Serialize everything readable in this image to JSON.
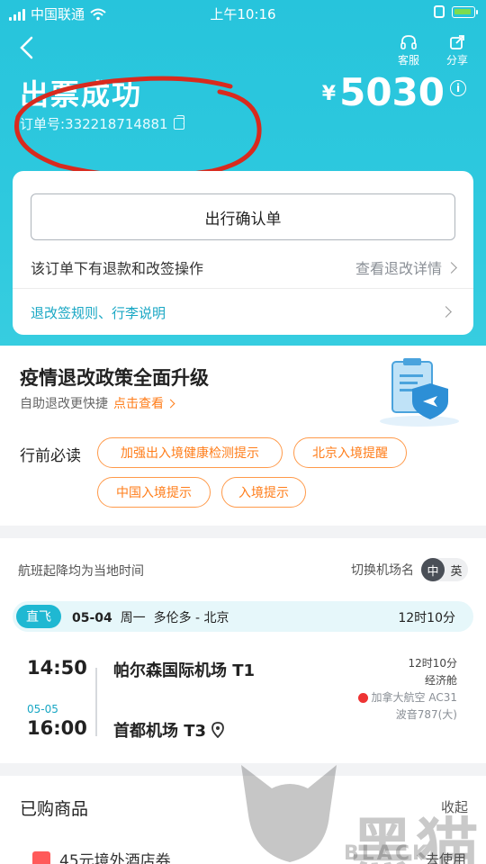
{
  "status_bar": {
    "carrier": "中国联通",
    "time": "上午10:16"
  },
  "header": {
    "actions": [
      {
        "label": "客服",
        "icon": "headset-icon"
      },
      {
        "label": "分享",
        "icon": "share-icon"
      }
    ],
    "title": "出票成功",
    "order_number": "订单号:332218714881",
    "currency": "¥",
    "price": "5030"
  },
  "ticket_card": {
    "confirm_button": "出行确认单",
    "refund_text": "该订单下有退款和改签操作",
    "refund_link": "查看退改详情",
    "rules_link": "退改签规则、行李说明"
  },
  "policy": {
    "title": "疫情退改政策全面升级",
    "subtitle": "自助退改更快捷",
    "link": "点击查看",
    "read_label": "行前必读",
    "chips": [
      "加强出入境健康检测提示",
      "北京入境提醒",
      "中国入境提示",
      "入境提示"
    ]
  },
  "flight": {
    "timezone_note": "航班起降均为当地时间",
    "switch_label": "切换机场名",
    "lang_on": "中",
    "lang_off": "英",
    "tag": "直飞",
    "date": "05-04",
    "weekday": "周一",
    "route": "多伦多 - 北京",
    "duration": "12时10分",
    "dep_time": "14:50",
    "dep_airport": "帕尔森国际机场 T1",
    "arr_date": "05-05",
    "arr_time": "16:00",
    "arr_airport": "首都机场 T3",
    "detail_duration": "12时10分",
    "cabin": "经济舱",
    "airline": "加拿大航空 AC31",
    "aircraft": "波音787(大)"
  },
  "goods": {
    "title": "已购商品",
    "collapse": "收起",
    "item": "45元境外酒店券",
    "use": "去使用"
  },
  "watermark": {
    "cn": "黑猫",
    "en": "BLACK CAT"
  },
  "colors": {
    "accent": "#27c4dc",
    "orange": "#ff7d1a",
    "link": "#19a7c4"
  }
}
